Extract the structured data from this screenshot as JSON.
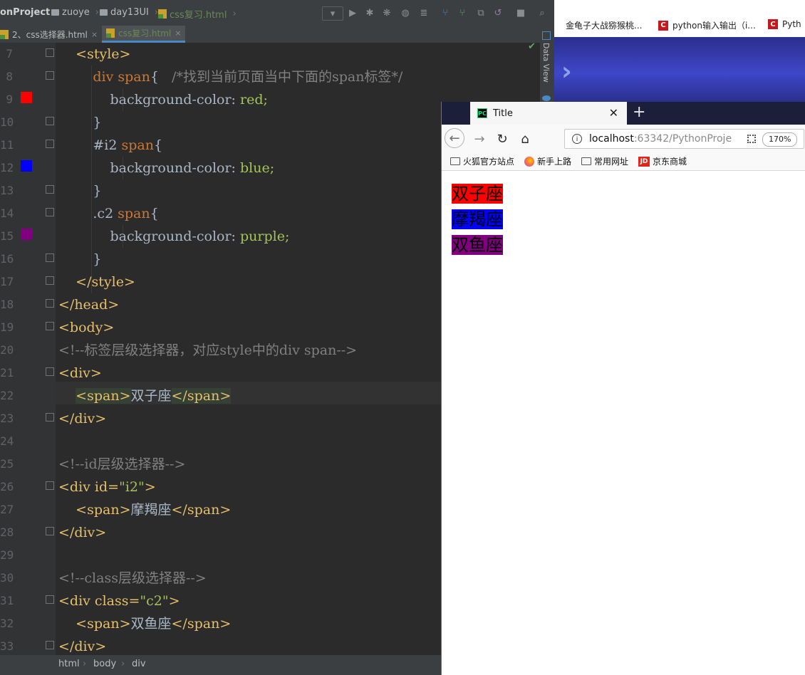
{
  "ide": {
    "breadcrumb": [
      "onProject",
      "zuoye",
      "day13UI",
      "css复习.html"
    ],
    "tabs": [
      {
        "label": "2、css选择器.html",
        "active": false
      },
      {
        "label": "css复习.html",
        "active": true
      }
    ],
    "tab_close": "×",
    "right_panel_label": "Data View",
    "status_breadcrumb": [
      "html",
      "body",
      "div"
    ],
    "line_numbers": [
      "7",
      "8",
      "9",
      "10",
      "11",
      "12",
      "13",
      "14",
      "15",
      "16",
      "17",
      "18",
      "19",
      "20",
      "21",
      "22",
      "23",
      "24",
      "25",
      "26",
      "27",
      "28",
      "29",
      "30",
      "31",
      "32",
      "33"
    ],
    "code": {
      "l7": "<style>",
      "l8_sel": "div span",
      "l8_brace": "{",
      "l8_comment": "/*找到当前页面当中下面的span标签*/",
      "l9_prop": "background-color:",
      "l9_val": "red;",
      "l10": "}",
      "l11_id": "#i2",
      "l11_sel": " span",
      "l11_brace": "{",
      "l12_prop": "background-color:",
      "l12_val": "blue;",
      "l13": "}",
      "l14_cls": ".c2",
      "l14_sel": " span",
      "l14_brace": "{",
      "l15_prop": "background-color:",
      "l15_val": "purple;",
      "l16": "}",
      "l17": "</style>",
      "l18": "</head>",
      "l19": "<body>",
      "l20": "<!--标签层级选择器，对应style中的div span-->",
      "l21": "<div>",
      "l22_open": "<span>",
      "l22_text": "双子座",
      "l22_close": "</span>",
      "l23": "</div>",
      "l25": "<!--id层级选择器-->",
      "l26_tag": "<div id=",
      "l26_val": "\"i2\"",
      "l26_end": ">",
      "l27_open": "<span>",
      "l27_text": "摩羯座",
      "l27_close": "</span>",
      "l28": "</div>",
      "l30": "<!--class层级选择器-->",
      "l31_tag": "<div class=",
      "l31_val": "\"c2\"",
      "l31_end": ">",
      "l32_open": "<span>",
      "l32_text": "双鱼座",
      "l32_close": "</span>",
      "l33": "</div>"
    },
    "swatch_colors": {
      "red": "#ff0000",
      "blue": "#0000ff",
      "purple": "#800080"
    }
  },
  "desktop_bookmarks": [
    {
      "label": "金龟子大战猕猴桃..."
    },
    {
      "label": "python输入输出（i..."
    },
    {
      "label": "Pyth"
    }
  ],
  "browser": {
    "tab_title": "Title",
    "tab_icon_text": "PC",
    "url_host": "localhost",
    "url_rest": ":63342/PythonProje",
    "zoom": "170%",
    "bookmarks": [
      "火狐官方站点",
      "新手上路",
      "常用网址",
      "京东商城"
    ],
    "jd_icon_text": "JD",
    "page": [
      {
        "text": "双子座",
        "bg": "#ff0000"
      },
      {
        "text": "摩羯座",
        "bg": "#0000ff"
      },
      {
        "text": "双鱼座",
        "bg": "#800080"
      }
    ]
  }
}
